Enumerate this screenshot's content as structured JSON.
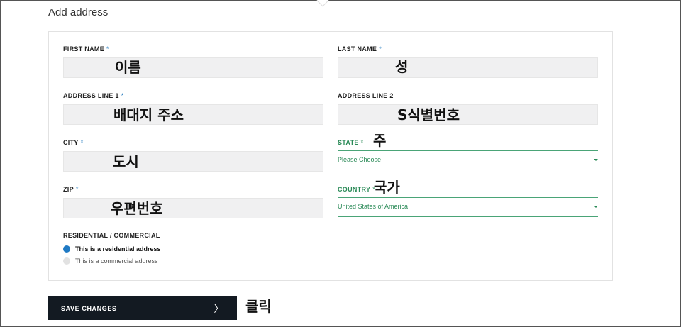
{
  "page": {
    "title": "Add address"
  },
  "form": {
    "first_name": {
      "label": "FIRST NAME",
      "required": "*",
      "annotation": "이름"
    },
    "last_name": {
      "label": "LAST NAME",
      "required": "*",
      "annotation": "성"
    },
    "address_line_1": {
      "label": "ADDRESS LINE 1",
      "required": "*",
      "annotation": "배대지 주소"
    },
    "address_line_2": {
      "label": "ADDRESS LINE 2",
      "annotation": "S식별번호"
    },
    "city": {
      "label": "CITY",
      "required": "*",
      "annotation": "도시"
    },
    "state": {
      "label": "STATE",
      "required": "*",
      "annotation": "주",
      "selected": "Please Choose"
    },
    "zip": {
      "label": "ZIP",
      "required": "*",
      "annotation": "우편번호"
    },
    "country": {
      "label": "COUNTRY",
      "required": "*",
      "annotation": "국가",
      "selected": "United States of America"
    },
    "residential": {
      "label": "RESIDENTIAL / COMMERCIAL",
      "options": [
        {
          "label": "This is a residential address",
          "checked": true
        },
        {
          "label": "This is a commercial address",
          "checked": false
        }
      ]
    }
  },
  "actions": {
    "save_label": "SAVE CHANGES",
    "save_annotation": "클릭"
  },
  "colors": {
    "accent_blue": "#1f7ac4",
    "accent_green": "#2a8a57",
    "button_bg": "#131a22"
  }
}
